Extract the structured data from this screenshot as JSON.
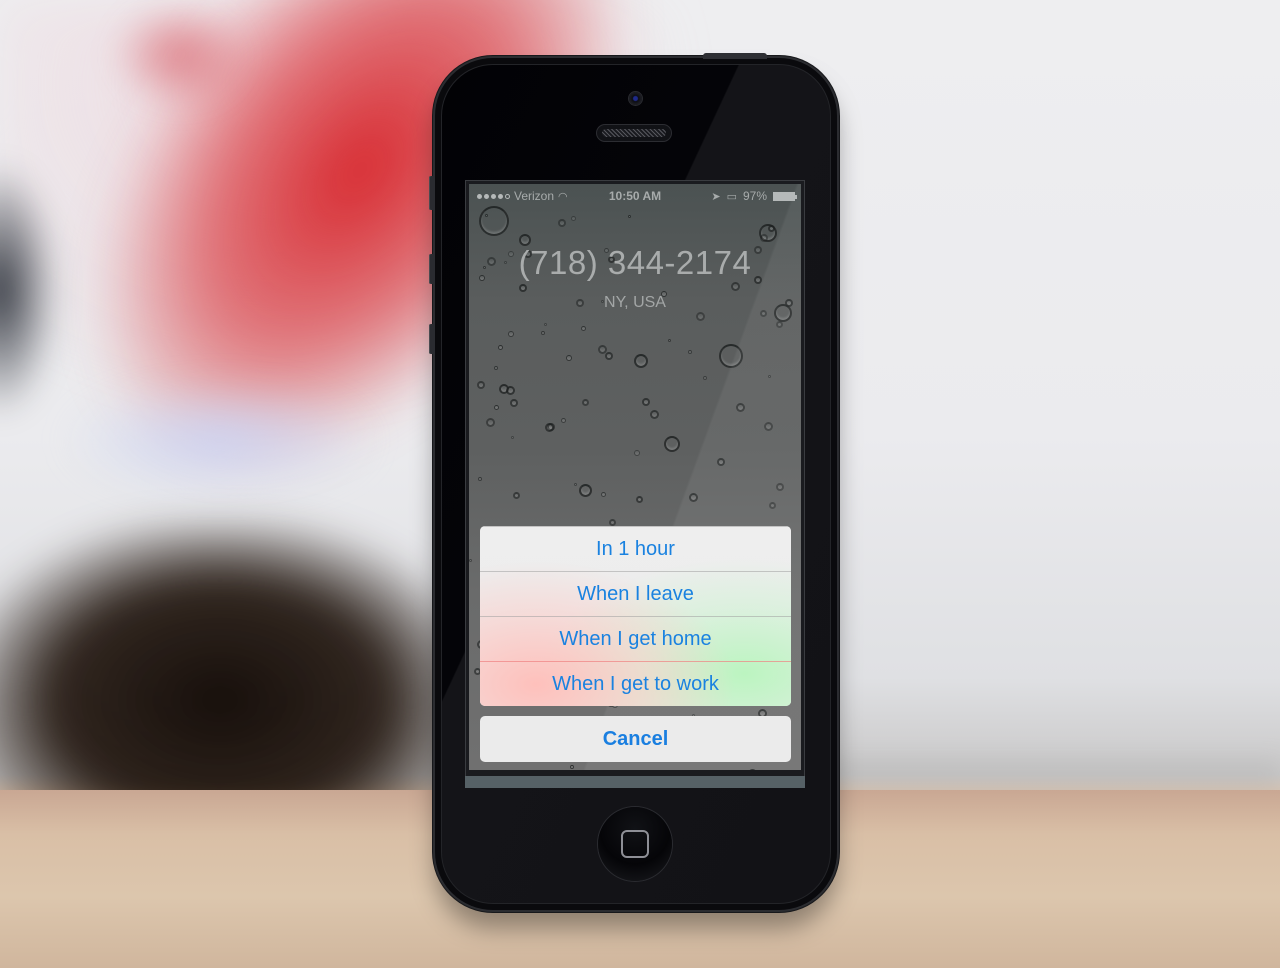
{
  "status_bar": {
    "signal_bars_filled": 4,
    "signal_bars_total": 5,
    "carrier": "Verizon",
    "wifi_icon": "wifi-icon",
    "time": "10:50 AM",
    "location_icon": "location-arrow-icon",
    "airplay_icon": "airplay-icon",
    "battery_percent": "97%",
    "battery_level": 0.97
  },
  "call": {
    "phone_number": "(718) 344-2174",
    "location": "NY, USA"
  },
  "action_sheet": {
    "options": [
      {
        "label": "In 1 hour"
      },
      {
        "label": "When I leave"
      },
      {
        "label": "When I get home"
      },
      {
        "label": "When I get to work"
      }
    ],
    "cancel_label": "Cancel"
  },
  "colors": {
    "action_blue": "#1a82e0",
    "sheet_background": "#ececec",
    "phone_body": "#0a0a0d"
  },
  "device": {
    "model_icon": "iphone-5-black",
    "home_button_icon": "home-square-icon"
  }
}
